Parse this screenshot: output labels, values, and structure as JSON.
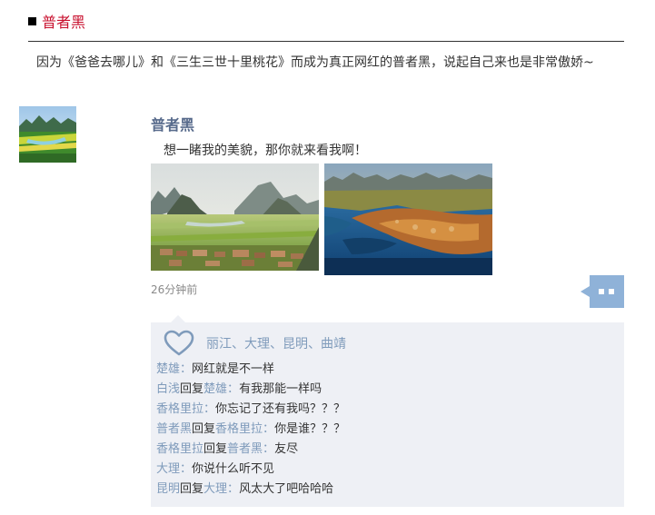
{
  "header": {
    "title": "普者黑"
  },
  "intro": {
    "text": "因为《爸爸去哪儿》和《三生三世十里桃花》而成为真正网红的普者黑，说起自己来也是非常傲娇~"
  },
  "post": {
    "user": "普者黑",
    "text": "想一睹我的美貌，那你就来看我啊！",
    "time": "26分钟前"
  },
  "likes": {
    "names": "丽江、大理、昆明、曲靖"
  },
  "comments": [
    {
      "author": "楚雄",
      "reply_word": "",
      "target": "",
      "sep": "：",
      "text": "网红就是不一样"
    },
    {
      "author": "白浅",
      "reply_word": "回复",
      "target": "楚雄",
      "sep": "：",
      "text": "有我那能一样吗"
    },
    {
      "author": "香格里拉",
      "reply_word": "",
      "target": "",
      "sep": "：",
      "text": "你忘记了还有我吗？？？"
    },
    {
      "author": "普者黑",
      "reply_word": "回复",
      "target": "香格里拉",
      "sep": "：",
      "text": "你是谁？？？"
    },
    {
      "author": "香格里拉",
      "reply_word": "回复",
      "target": "普者黑",
      "sep": "：",
      "text": "友尽"
    },
    {
      "author": "大理",
      "reply_word": "",
      "target": "",
      "sep": "：",
      "text": "你说什么听不见"
    },
    {
      "author": "昆明",
      "reply_word": "回复",
      "target": "大理",
      "sep": "：",
      "text": "风太大了吧哈哈哈"
    }
  ],
  "icons": {
    "header_marker": "square-bullet-icon",
    "like": "heart-icon",
    "comment": "comment-bubble-icon"
  },
  "colors": {
    "title": "#c8102e",
    "name": "#586b8c",
    "link": "#7f9bbb",
    "comment_bg": "#eef0f5",
    "comment_button": "#8fb2d8"
  }
}
